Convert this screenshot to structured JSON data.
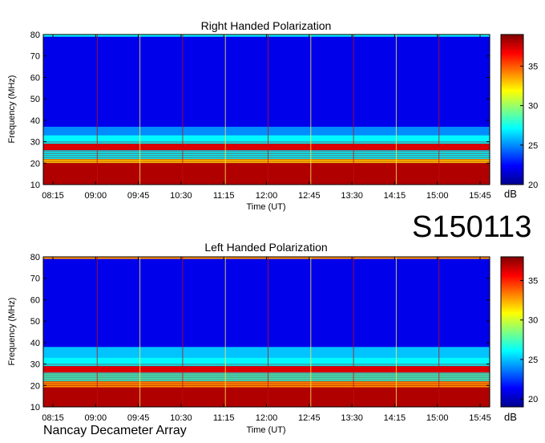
{
  "chart_data": [
    {
      "type": "heatmap",
      "title": "Right Handed Polarization",
      "xlabel": "Time (UT)",
      "ylabel": "Frequency (MHz)",
      "ylim": [
        10,
        80
      ],
      "xticks": [
        "08:15",
        "09:00",
        "09:45",
        "10:30",
        "11:15",
        "12:00",
        "12:45",
        "13:30",
        "14:15",
        "15:00",
        "15:45"
      ],
      "yticks": [
        10,
        20,
        30,
        40,
        50,
        60,
        70,
        80
      ],
      "colorbar": {
        "label": "dB",
        "range": [
          20,
          39
        ],
        "ticks": [
          20,
          25,
          30,
          35
        ]
      },
      "colormap": "jet",
      "bands": [
        {
          "freq_range": [
            10,
            20
          ],
          "level_db": 38
        },
        {
          "freq_range": [
            20,
            22
          ],
          "level_db": 33
        },
        {
          "freq_range": [
            22,
            26
          ],
          "level_db": 27
        },
        {
          "freq_range": [
            26,
            29
          ],
          "level_db": 37
        },
        {
          "freq_range": [
            29,
            33
          ],
          "level_db": 27
        },
        {
          "freq_range": [
            33,
            37
          ],
          "level_db": 25
        },
        {
          "freq_range": [
            37,
            79
          ],
          "level_db": 22
        },
        {
          "freq_range": [
            79,
            80
          ],
          "level_db": 27
        }
      ]
    },
    {
      "type": "heatmap",
      "title": "Left Handed Polarization",
      "xlabel": "Time (UT)",
      "ylabel": "Frequency (MHz)",
      "ylim": [
        10,
        80
      ],
      "xticks": [
        "08:15",
        "09:00",
        "09:45",
        "10:30",
        "11:15",
        "12:00",
        "12:45",
        "13:30",
        "14:15",
        "15:00",
        "15:45"
      ],
      "yticks": [
        10,
        20,
        30,
        40,
        50,
        60,
        70,
        80
      ],
      "colorbar": {
        "label": "dB",
        "range": [
          19,
          38
        ],
        "ticks": [
          20,
          25,
          30,
          35
        ]
      },
      "colormap": "jet",
      "bands": [
        {
          "freq_range": [
            10,
            19
          ],
          "level_db": 37
        },
        {
          "freq_range": [
            19,
            22
          ],
          "level_db": 33
        },
        {
          "freq_range": [
            22,
            26
          ],
          "level_db": 27
        },
        {
          "freq_range": [
            26,
            29
          ],
          "level_db": 36
        },
        {
          "freq_range": [
            29,
            33
          ],
          "level_db": 26
        },
        {
          "freq_range": [
            33,
            38
          ],
          "level_db": 25
        },
        {
          "freq_range": [
            38,
            79
          ],
          "level_db": 21
        },
        {
          "freq_range": [
            79,
            80
          ],
          "level_db": 33
        }
      ]
    }
  ],
  "observation_id": "S150113",
  "observatory": "Nancay Decameter Array"
}
